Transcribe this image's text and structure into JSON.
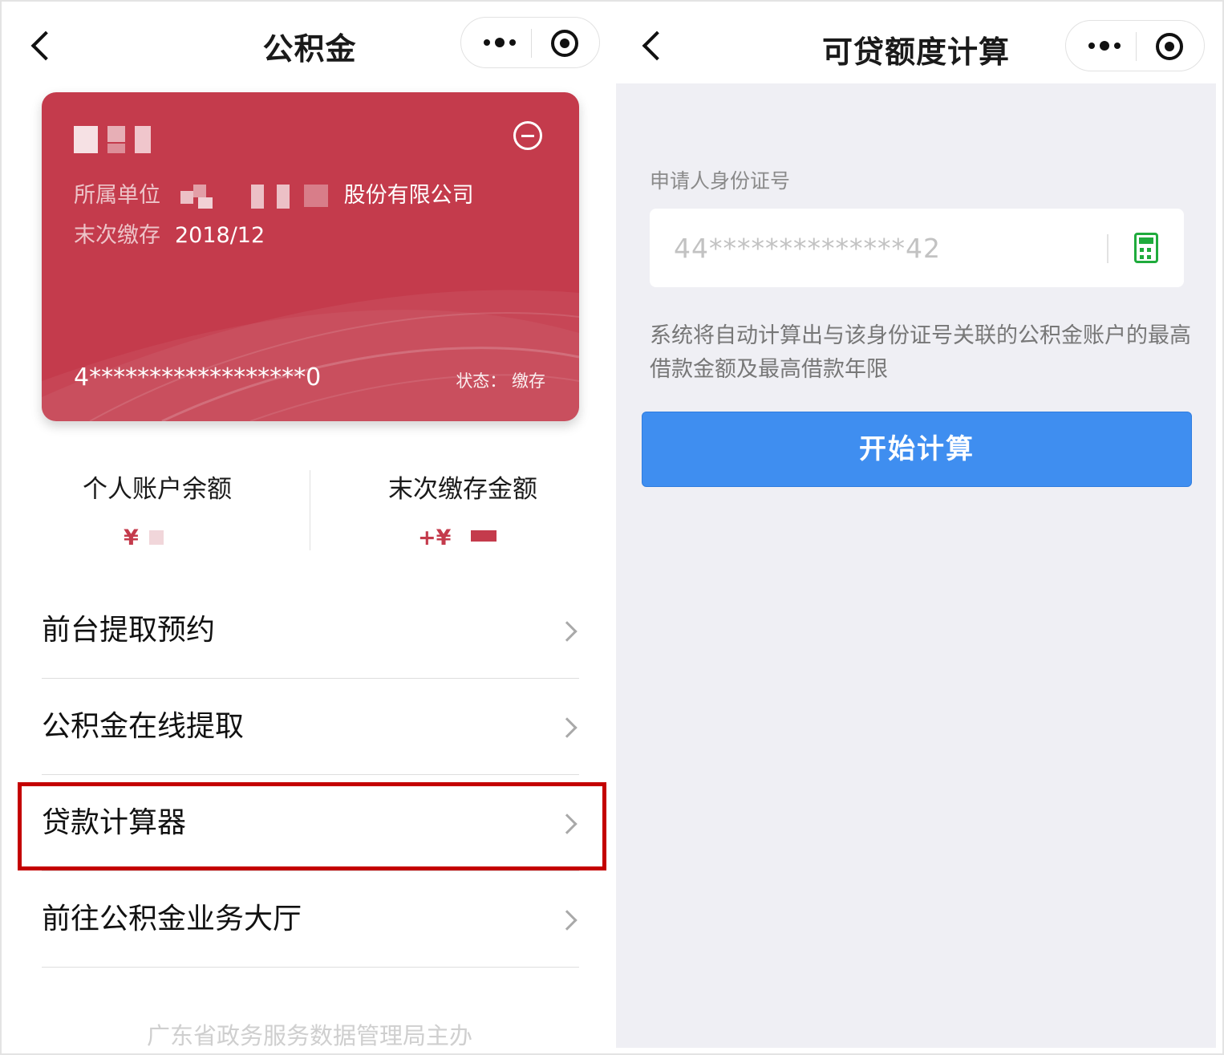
{
  "left_panel": {
    "nav_title": "公积金",
    "card": {
      "unit_label": "所属单位",
      "unit_suffix": "股份有限公司",
      "last_payment_label": "末次缴存",
      "last_payment_value": "2018/12",
      "card_number": "4******************0",
      "status": "状态：  缴存",
      "color": "#c43b4c"
    },
    "stats": {
      "balance_label": "个人账户余额",
      "balance_currency": "¥",
      "last_amount_label": "末次缴存金额",
      "last_amount_currency": "+¥"
    },
    "menu": [
      {
        "label": "前台提取预约"
      },
      {
        "label": "公积金在线提取"
      },
      {
        "label": "贷款计算器"
      },
      {
        "label": "前往公积金业务大厅"
      }
    ],
    "footer": "广东省政务服务数据管理局主办"
  },
  "right_panel": {
    "nav_title": "可贷额度计算",
    "id_label": "申请人身份证号",
    "id_placeholder": "44**************42",
    "description": "系统将自动计算出与该身份证号关联的公积金账户的最高借款金额及最高借款年限",
    "start_button": "开始计算",
    "accent": "#3f8ef0",
    "calc_icon_color": "#1fab3c"
  }
}
